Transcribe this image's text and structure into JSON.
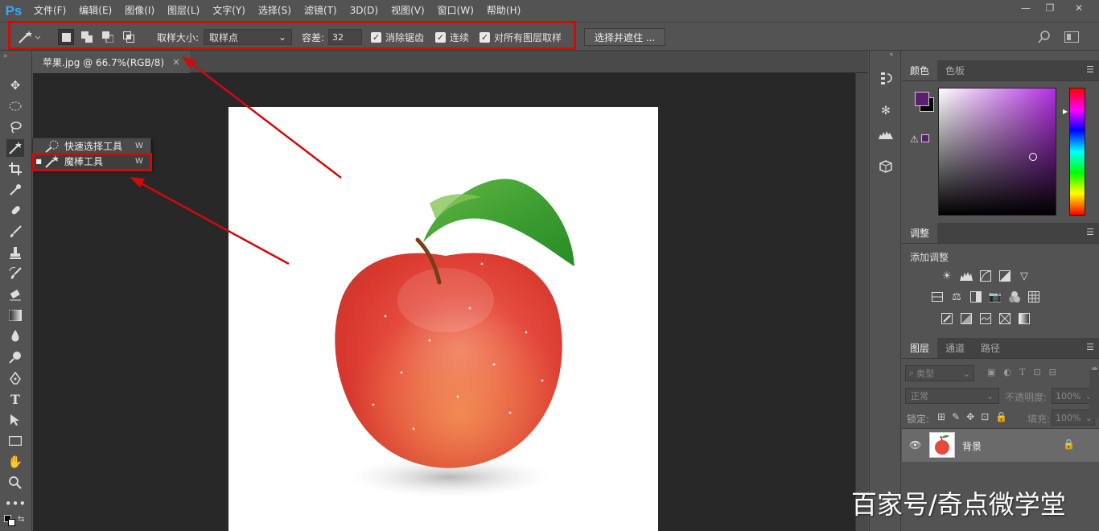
{
  "app": {
    "logo": "Ps"
  },
  "menu": [
    "文件(F)",
    "编辑(E)",
    "图像(I)",
    "图层(L)",
    "文字(Y)",
    "选择(S)",
    "滤镜(T)",
    "3D(D)",
    "视图(V)",
    "窗口(W)",
    "帮助(H)"
  ],
  "window_controls": {
    "minimize": "—",
    "restore": "❐",
    "close": "✕"
  },
  "options": {
    "sample_size_label": "取样大小:",
    "sample_size_value": "取样点",
    "tolerance_label": "容差:",
    "tolerance_value": "32",
    "antialias_label": "消除锯齿",
    "contiguous_label": "连续",
    "all_layers_label": "对所有图层取样",
    "select_mask_button": "选择并遮住 ..."
  },
  "document": {
    "tab_title": "苹果.jpg @ 66.7%(RGB/8)",
    "close": "×"
  },
  "tool_flyout": [
    {
      "label": "快速选择工具",
      "shortcut": "W"
    },
    {
      "label": "魔棒工具",
      "shortcut": "W"
    }
  ],
  "color_panel": {
    "tabs": [
      "颜色",
      "色板"
    ],
    "foreground": "#5b1f72",
    "background": "#000000"
  },
  "adjustments_panel": {
    "tab": "调整",
    "title": "添加调整"
  },
  "layers_panel": {
    "tabs": [
      "图层",
      "通道",
      "路径"
    ],
    "filter_placeholder": "类型",
    "blend_mode": "正常",
    "opacity_label": "不透明度:",
    "opacity_value": "100%",
    "lock_label": "锁定:",
    "fill_label": "填充:",
    "fill_value": "100%",
    "layer_name": "背景"
  },
  "watermark": "百家号/奇点微学堂",
  "colors": {
    "highlight_box": "#d10a0a",
    "accent": "#31a8ff"
  }
}
